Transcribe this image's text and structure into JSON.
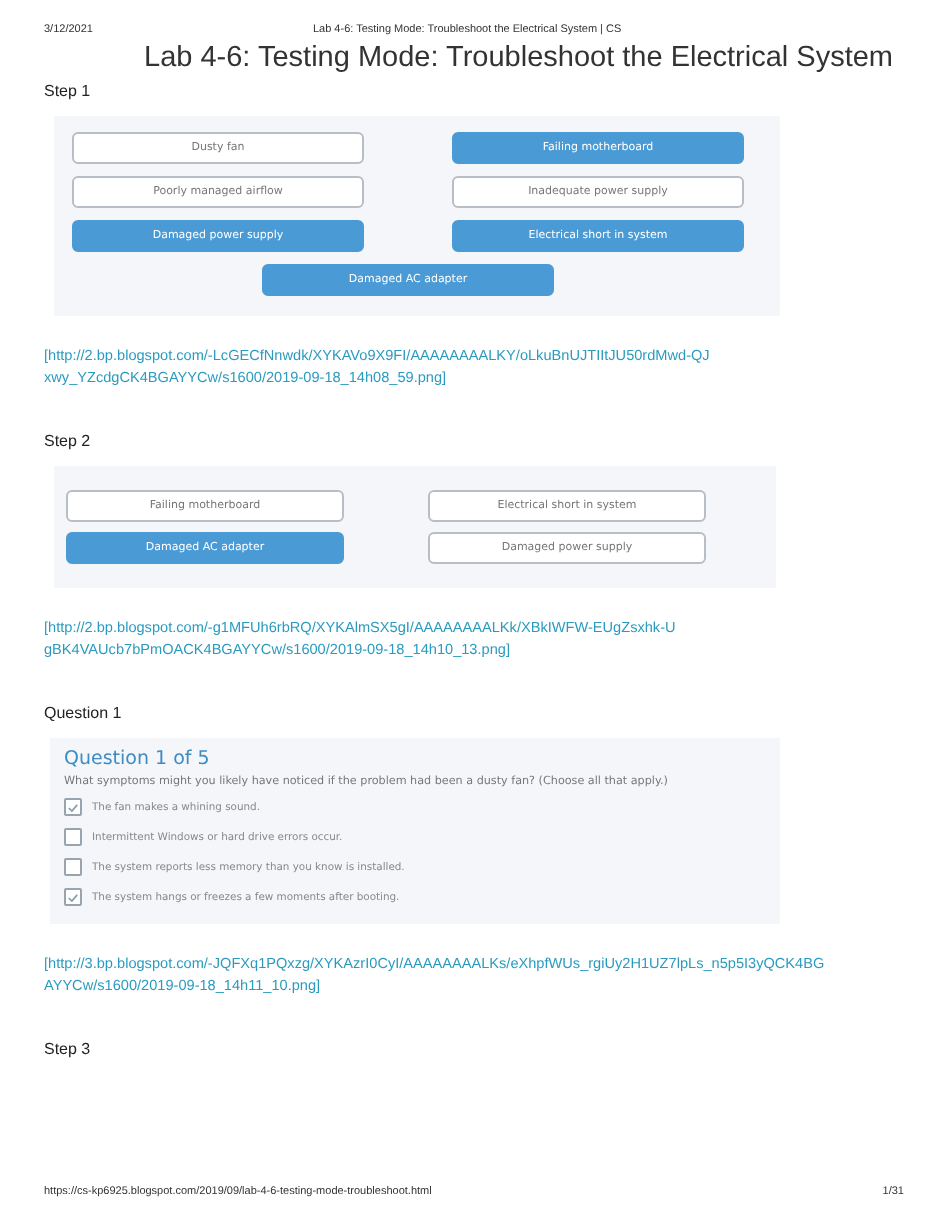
{
  "print_header": {
    "date": "3/12/2021",
    "page_title": "Lab 4-6: Testing Mode: Troubleshoot the Electrical System | CS"
  },
  "title": "Lab 4-6: Testing Mode: Troubleshoot the Electrical System",
  "sections": [
    {
      "kind": "options",
      "heading": "Step 1",
      "options": [
        {
          "label": "Dusty fan",
          "selected": false
        },
        {
          "label": "Failing motherboard",
          "selected": true
        },
        {
          "label": "Poorly managed airflow",
          "selected": false
        },
        {
          "label": "Inadequate power supply",
          "selected": false
        },
        {
          "label": "Damaged power supply",
          "selected": true
        },
        {
          "label": "Electrical short in system",
          "selected": true
        },
        {
          "label": "Damaged AC adapter",
          "selected": true
        }
      ],
      "link": "[http://2.bp.blogspot.com/-LcGECfNnwdk/XYKAVo9X9FI/AAAAAAAALKY/oLkuBnUJTIItJU50rdMwd-QJxwy_YZcdgCK4BGAYYCw/s1600/2019-09-18_14h08_59.png]"
    },
    {
      "kind": "options",
      "heading": "Step 2",
      "options": [
        {
          "label": "Failing motherboard",
          "selected": false
        },
        {
          "label": "Electrical short in system",
          "selected": false
        },
        {
          "label": "Damaged AC adapter",
          "selected": true
        },
        {
          "label": "Damaged power supply",
          "selected": false
        }
      ],
      "link": "[http://2.bp.blogspot.com/-g1MFUh6rbRQ/XYKAlmSX5gI/AAAAAAAALKk/XBkIWFW-EUgZsxhk-UgBK4VAUcb7bPmOACK4BGAYYCw/s1600/2019-09-18_14h10_13.png]"
    },
    {
      "kind": "question",
      "heading": "Question 1",
      "question_title": "Question 1 of 5",
      "prompt": "What symptoms might you likely have noticed if the problem had been a dusty fan? (Choose all that apply.)",
      "answers": [
        {
          "label": "The fan makes a whining sound.",
          "checked": true
        },
        {
          "label": "Intermittent Windows or hard drive errors occur.",
          "checked": false
        },
        {
          "label": "The system reports less memory than you know is installed.",
          "checked": false
        },
        {
          "label": "The system hangs or freezes a few moments after booting.",
          "checked": true
        }
      ],
      "link": "[http://3.bp.blogspot.com/-JQFXq1PQxzg/XYKAzrI0CyI/AAAAAAAALKs/eXhpfWUs_rgiUy2H1UZ7lpLs_n5p5I3yQCK4BGAYYCw/s1600/2019-09-18_14h11_10.png]"
    },
    {
      "kind": "heading",
      "heading": "Step 3"
    }
  ],
  "print_footer": {
    "url": "https://cs-kp6925.blogspot.com/2019/09/lab-4-6-testing-mode-troubleshoot.html",
    "page": "1/31"
  }
}
